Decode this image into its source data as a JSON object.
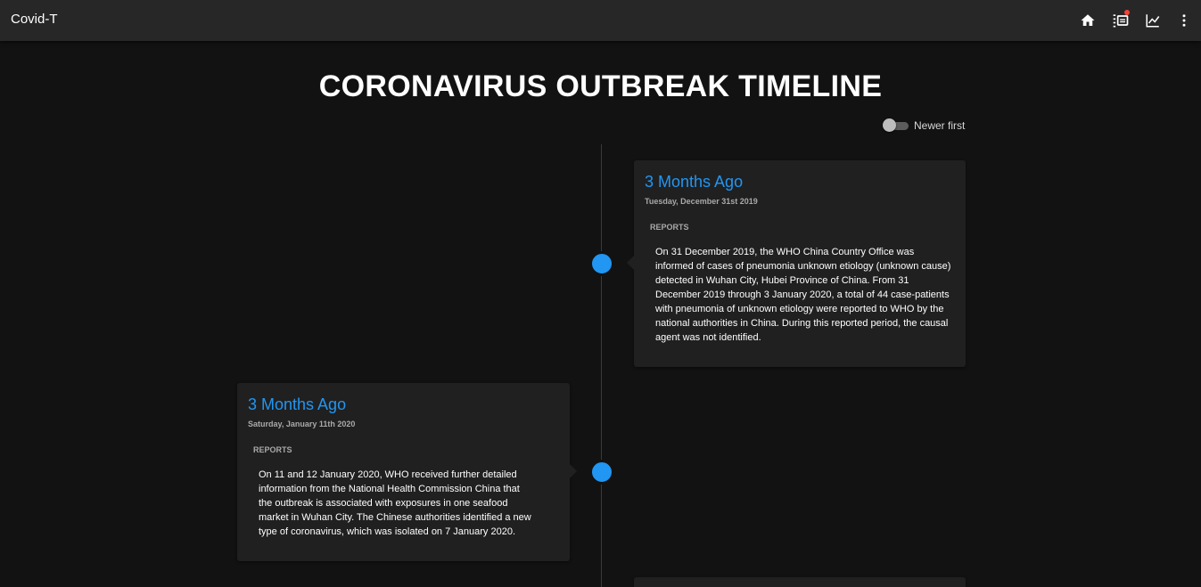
{
  "app": {
    "title": "Covid-T"
  },
  "toolbar_icons": [
    "home-icon",
    "timeline-list-icon",
    "chart-icon",
    "more-vertical-icon"
  ],
  "page": {
    "title": "CORONAVIRUS OUTBREAK TIMELINE",
    "sort_toggle": {
      "label": "Newer first",
      "checked": false
    }
  },
  "colors": {
    "accent": "#2196f3",
    "background": "#121212",
    "appbar": "#272727",
    "card": "#202020",
    "notification": "#f44336"
  },
  "timeline": [
    {
      "relative_time": "3 Months Ago",
      "date": "Tuesday, December 31st 2019",
      "section": "REPORTS",
      "text": "On 31 December 2019, the WHO China Country Office was informed of cases of pneumonia unknown etiology (unknown cause) detected in Wuhan City, Hubei Province of China. From 31 December 2019 through 3 January 2020, a total of 44 case-patients with pneumonia of unknown etiology were reported to WHO by the national authorities in China. During this reported period, the causal agent was not identified."
    },
    {
      "relative_time": "3 Months Ago",
      "date": "Saturday, January 11th 2020",
      "section": "REPORTS",
      "text": "On 11 and 12 January 2020, WHO received further detailed information from the National Health Commission China that the outbreak is associated with exposures in one seafood market in Wuhan City. The Chinese authorities identified a new type of coronavirus, which was isolated on 7 January 2020."
    }
  ]
}
